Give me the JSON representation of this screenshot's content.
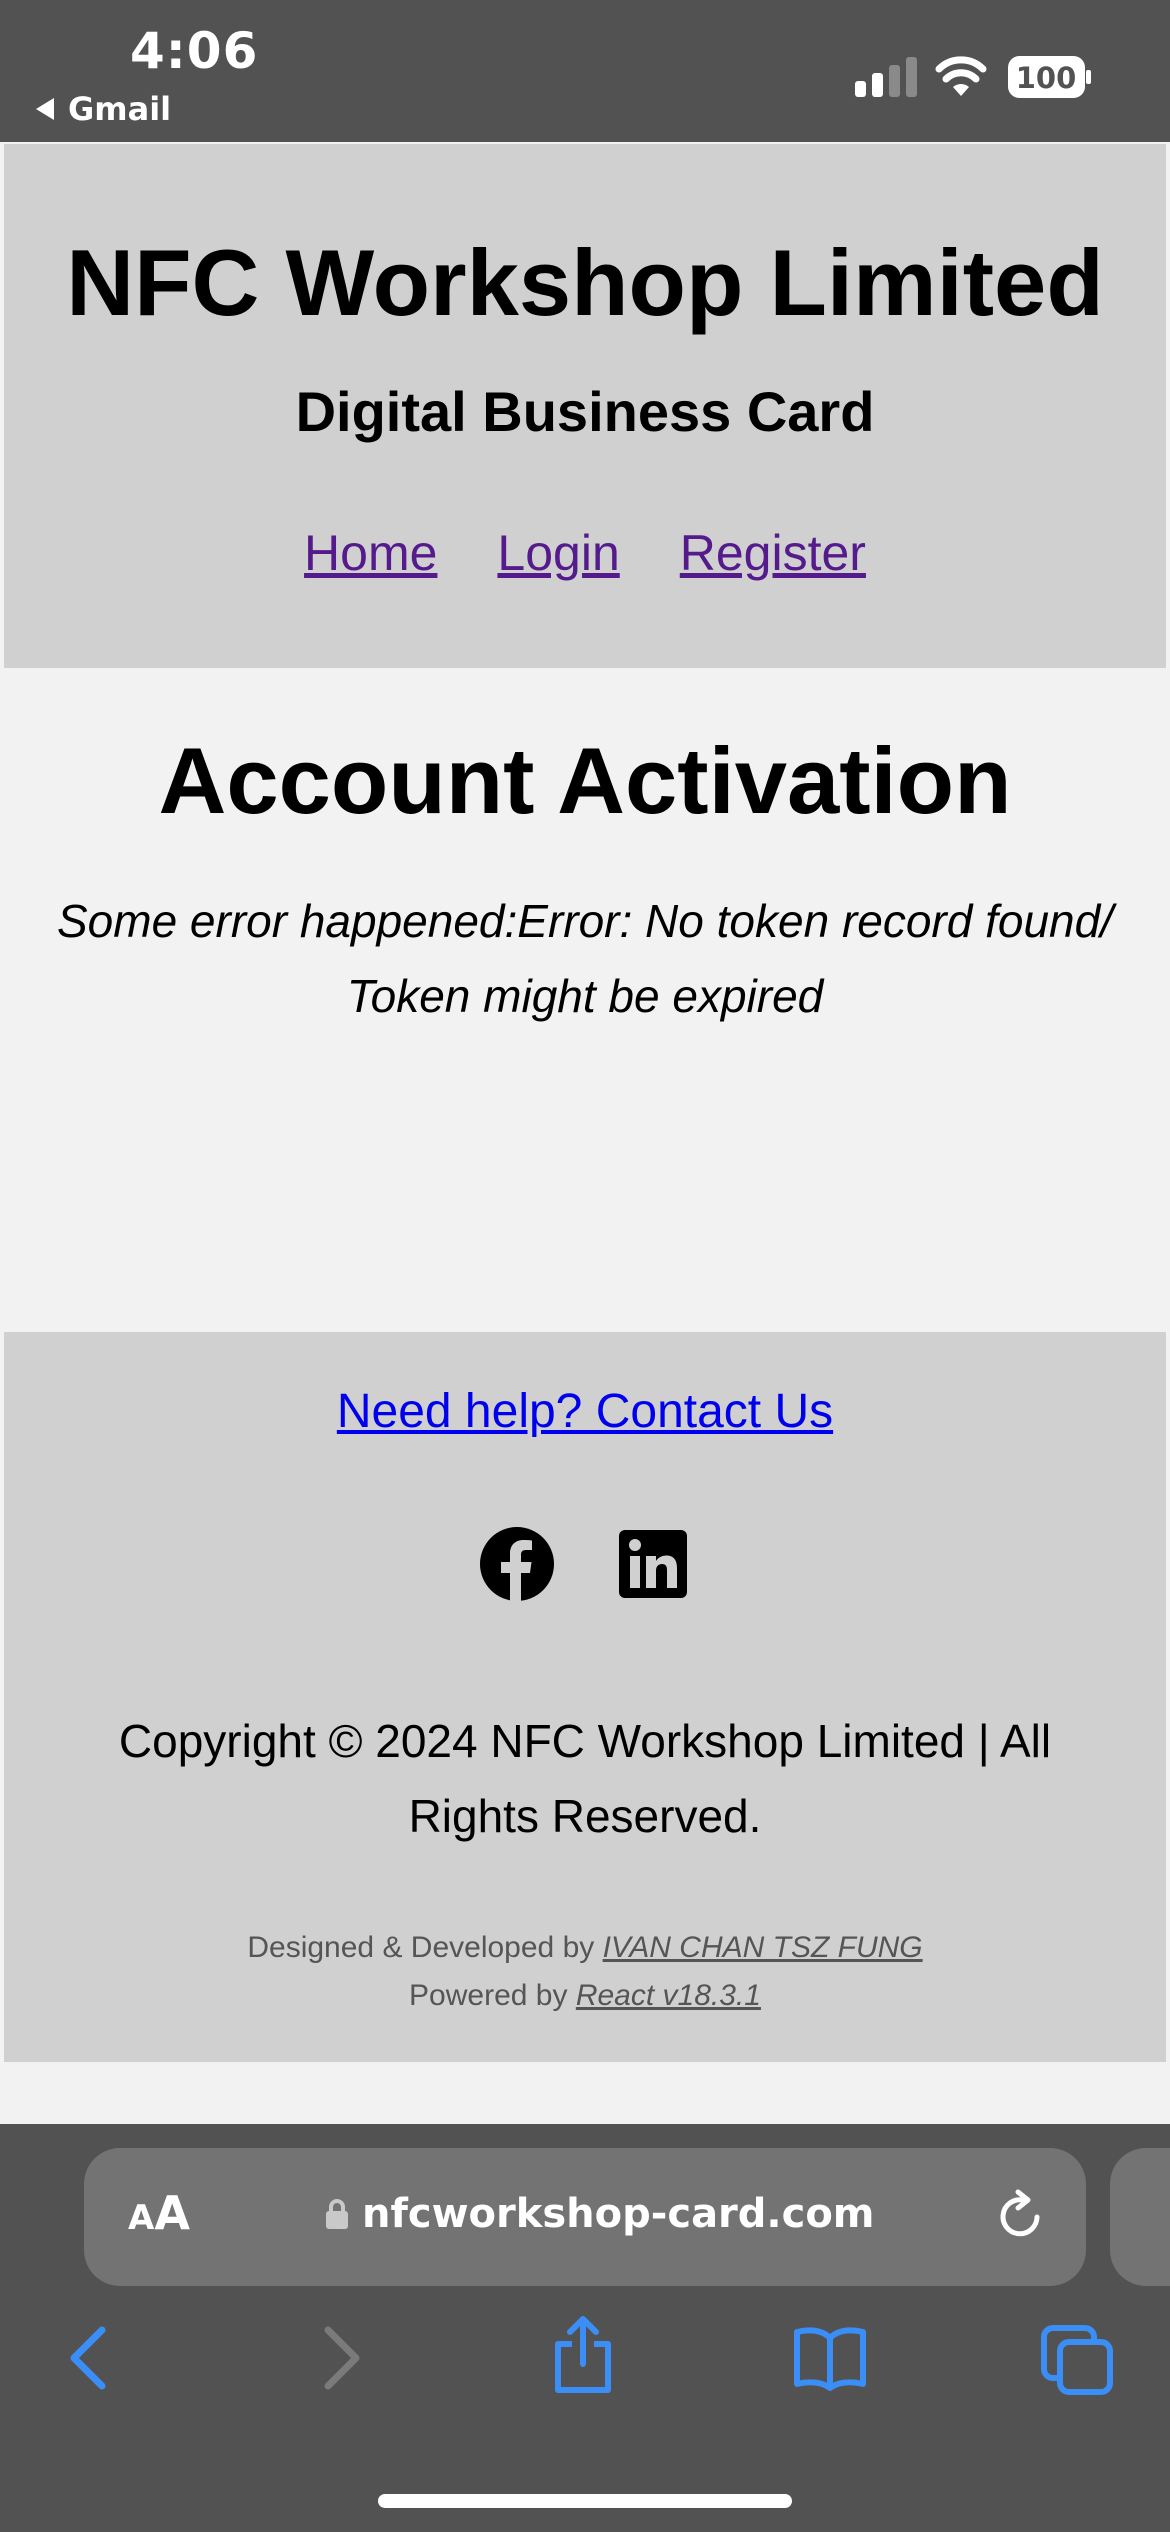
{
  "status_bar": {
    "time": "4:06",
    "back_app": "Gmail",
    "battery": "100"
  },
  "header": {
    "title": "NFC Workshop Limited",
    "subtitle": "Digital Business Card",
    "nav": [
      {
        "label": "Home"
      },
      {
        "label": "Login"
      },
      {
        "label": "Register"
      }
    ]
  },
  "main": {
    "page_title": "Account Activation",
    "error_message": "Some error happened:Error: No token record found/ Token might be expired"
  },
  "footer": {
    "help_link": "Need help? Contact Us",
    "social_icons": [
      "facebook-icon",
      "linkedin-icon"
    ],
    "copyright": "Copyright © 2024 NFC Workshop Limited | All Rights Reserved.",
    "designed_prefix": "Designed & Developed by",
    "designer": "IVAN CHAN TSZ FUNG",
    "powered_prefix": "Powered by",
    "powered_by": "React v18.3.1"
  },
  "browser": {
    "text_size_small": "A",
    "text_size_big": "A",
    "url": "nfcworkshop-card.com",
    "toolbar_icons": [
      "back-icon",
      "forward-icon",
      "share-icon",
      "bookmarks-icon",
      "tabs-icon"
    ]
  },
  "colors": {
    "status_bar_bg": "#525252",
    "header_bg": "#d0d0d0",
    "page_bg": "#f2f2f2",
    "visited_link": "#551a8b",
    "link": "#0000ee",
    "browser_accent": "#3a8ef6"
  }
}
